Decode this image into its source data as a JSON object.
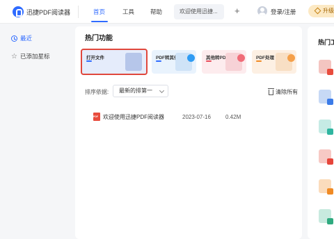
{
  "app": {
    "title": "迅捷PDF阅读器"
  },
  "nav": {
    "tabs": [
      "首页",
      "工具",
      "帮助"
    ],
    "doc_tab": "欢迎使用迅捷...",
    "plus": "+"
  },
  "user": {
    "login": "登录/注册",
    "upgrade": "升级"
  },
  "sidebar": {
    "items": [
      {
        "label": "最近",
        "icon": "clock-icon"
      },
      {
        "label": "已添加星标",
        "icon": "star-icon"
      }
    ]
  },
  "main": {
    "title": "热门功能",
    "cards": [
      {
        "label": "打开文件",
        "color": "#2f6bff"
      },
      {
        "label": "PDF转其他",
        "color": "#2f9cf4"
      },
      {
        "label": "其他转PDF",
        "color": "#e84c5a"
      },
      {
        "label": "PDF处理",
        "color": "#f08a24"
      }
    ],
    "sort_label": "排序依据:",
    "sort_value": "最新的排第一",
    "clear_all": "清除所有",
    "files": [
      {
        "name": "欢迎使用迅捷PDF阅读器",
        "date": "2023-07-16",
        "size": "0.42M"
      }
    ]
  },
  "right": {
    "title": "热门工"
  }
}
